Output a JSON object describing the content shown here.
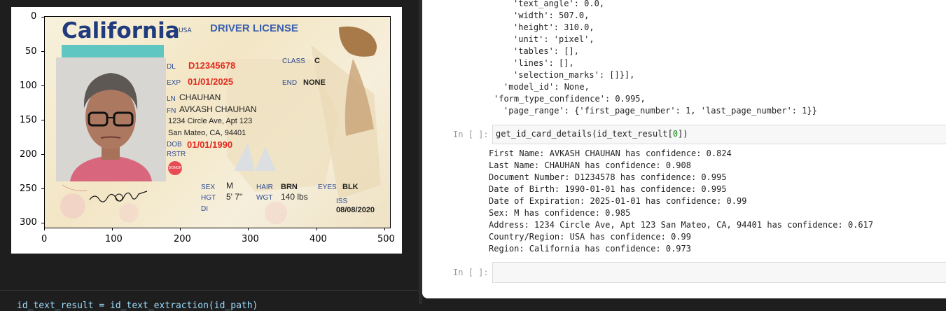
{
  "plot": {
    "x_ticks": [
      "0",
      "100",
      "200",
      "300",
      "400",
      "500"
    ],
    "y_ticks": [
      "0",
      "50",
      "100",
      "150",
      "200",
      "250",
      "300"
    ]
  },
  "id_card": {
    "state": "California",
    "country_small": "USA",
    "doc_type": "DRIVER LICENSE",
    "dl_label": "DL",
    "dl_value": "D12345678",
    "exp_label": "EXP",
    "exp_value": "01/01/2025",
    "class_label": "CLASS",
    "class_value": "C",
    "end_label": "END",
    "end_value": "NONE",
    "ln_label": "LN",
    "ln_value": "CHAUHAN",
    "fn_label": "FN",
    "fn_value": "AVKASH CHAUHAN",
    "addr1": "1234 Circle Ave, Apt 123",
    "addr2": "San Mateo, CA, 94401",
    "dob_label": "DOB",
    "dob_value": "01/01/1990",
    "rstr_label": "RSTR",
    "donor": "DONOR",
    "sex_label": "SEX",
    "sex_value": "M",
    "hair_label": "HAIR",
    "hair_value": "BRN",
    "eyes_label": "EYES",
    "eyes_value": "BLK",
    "hgt_label": "HGT",
    "hgt_value": "5' 7\"",
    "wgt_label": "WGT",
    "wgt_value": "140 lbs",
    "dd_label": "DI",
    "iss_label": "ISS",
    "iss_value": "08/08/2020"
  },
  "bottom_code": "id_text_result = id_text_extraction(id_path)",
  "code_lines": [
    "'text_angle': 0.0,",
    "'width': 507.0,",
    "'height': 310.0,",
    "'unit': 'pixel',",
    "'tables': [],",
    "'lines': [],",
    "'selection_marks': []}],",
    "'model_id': None,",
    "'form_type_confidence': 0.995,",
    "'page_range': {'first_page_number': 1, 'last_page_number': 1}}"
  ],
  "cell1": {
    "prompt": "In [ ]:",
    "code_fn": "get_id_card_details(id_text_result[",
    "code_num": "0",
    "code_end": "])"
  },
  "output_lines": [
    "First Name: AVKASH CHAUHAN has confidence: 0.824",
    "Last Name: CHAUHAN has confidence: 0.908",
    "Document Number: D1234578 has confidence: 0.995",
    "Date of Birth: 1990-01-01 has confidence: 0.995",
    "Date of Expiration: 2025-01-01 has confidence: 0.99",
    "Sex: M has confidence: 0.985",
    "Address: 1234 Circle Ave, Apt 123 San Mateo, CA, 94401 has confidence: 0.617",
    "Country/Region: USA has confidence: 0.99",
    "Region: California has confidence: 0.973"
  ],
  "cell2": {
    "prompt": "In [ ]:"
  }
}
